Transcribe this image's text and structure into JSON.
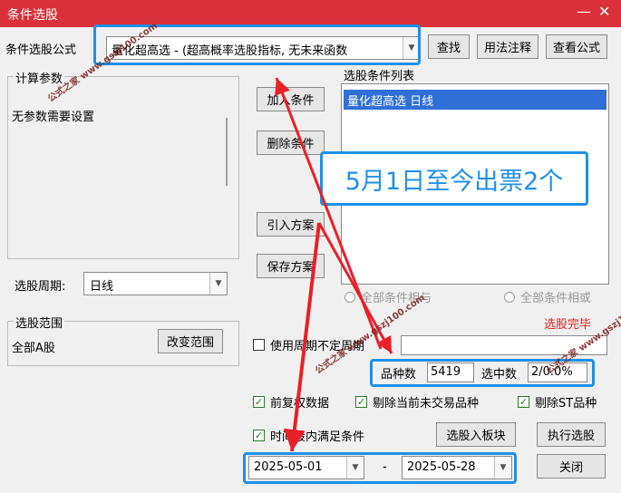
{
  "window": {
    "title": "条件选股",
    "minimize": "—",
    "close": "✕"
  },
  "formula": {
    "label": "条件选股公式",
    "value": "量化超高选 - (超高概率选股指标, 无未来函数",
    "find": "查找",
    "usage": "用法注释",
    "view": "查看公式"
  },
  "params": {
    "group_title": "计算参数",
    "text": "无参数需要设置"
  },
  "period": {
    "label": "选股周期:",
    "value": "日线"
  },
  "buttons": {
    "add": "加入条件",
    "remove": "删除条件",
    "import": "引入方案",
    "save": "保存方案",
    "change_range": "改变范围",
    "select_into": "选股入板块",
    "execute": "执行选股",
    "close": "关闭"
  },
  "conditions": {
    "title": "选股条件列表",
    "items": [
      "量化超高选  日线"
    ]
  },
  "annotation": "5月1日至今出票2个",
  "logic": {
    "and_label": "全部条件相与",
    "or_label": "全部条件相或"
  },
  "result_label": "选股完毕",
  "range": {
    "group_title": "选股范围",
    "value": "全部A股"
  },
  "options": {
    "use_period": "使用周期不定周期",
    "restore_rights": "前复权数据",
    "exclude_untraded": "剔除当前未交易品种",
    "exclude_st": "剔除ST品种",
    "time_range": "时间段内满足条件"
  },
  "stats": {
    "total_label": "品种数",
    "total_value": "5419",
    "selected_label": "选中数",
    "selected_value": "2/0.0%"
  },
  "dates": {
    "start": "2025-05-01",
    "separator": "-",
    "end": "2025-05-28"
  },
  "watermark": {
    "text": "公式之家",
    "url": "www.gszj100.com"
  },
  "colors": {
    "titlebar": "#d9303a",
    "highlight": "#1e90e8",
    "arrow": "#e8202a",
    "selection": "#2f6fd6"
  }
}
